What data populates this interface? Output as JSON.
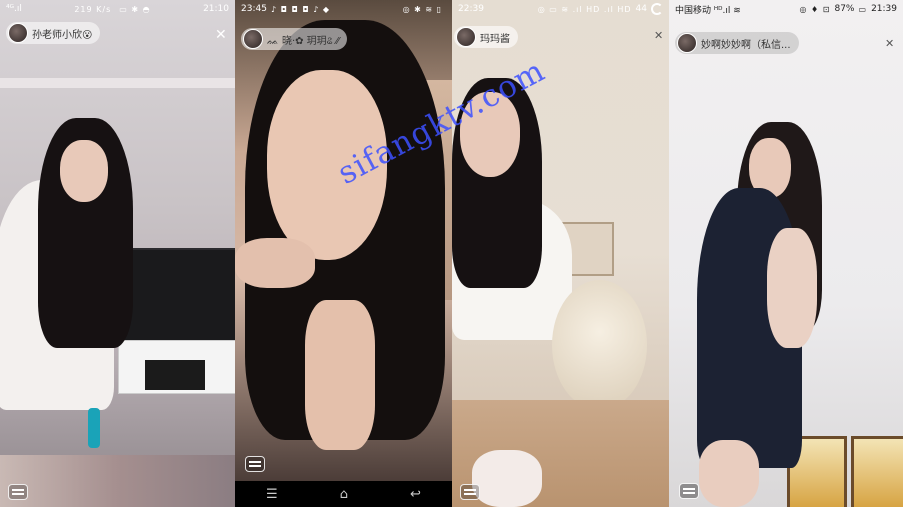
{
  "watermark": "sifangktv.com",
  "panels": [
    {
      "status": {
        "left": "⁴ᴳ.ıl",
        "right_icons": "▭ ✱ ◓",
        "time": "21:10",
        "net": "219 K/s"
      },
      "user": "孙老师小欣😮",
      "close_icon": "close-icon"
    },
    {
      "status": {
        "left": "23:45",
        "left_icons": "♪ ◘ ◘ ◘ ♪ ◆",
        "right_icons": "◎ ✱ ≋ ▯",
        "time": ""
      },
      "user": "ᨐ 晓·✿ 玥玥ଌ ⁄⁄",
      "nav": [
        "☰",
        "⌂",
        "↩"
      ]
    },
    {
      "status": {
        "left": "22:39",
        "right_icons": "◎ ▭ ≋ .ıl HD .ıl HD",
        "battery": "44"
      },
      "user": "玛玛酱"
    },
    {
      "status": {
        "left": "中国移动 ᴴᴰ.ıl ≋",
        "right_icons": "◎ ♦ ⊡",
        "battery": "87%",
        "time": "21:39"
      },
      "user": "妙啊妙妙啊（私信..."
    }
  ]
}
